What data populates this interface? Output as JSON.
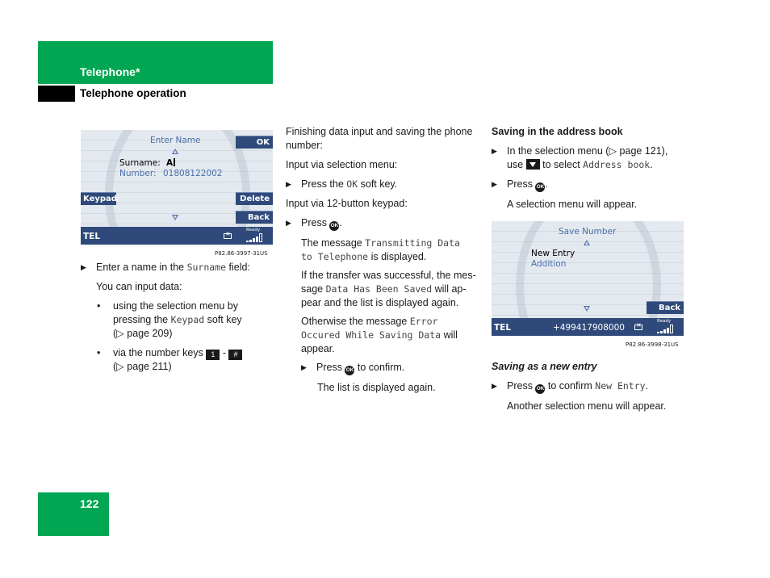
{
  "header": {
    "chapter": "Telephone*",
    "section": "Telephone operation"
  },
  "page_number": "122",
  "screen1": {
    "title": "Enter Name",
    "surname_label": "Surname:",
    "surname_value": "A",
    "number_label": "Number:",
    "number_value": "01808122002",
    "softkeys": {
      "ok": "OK",
      "keypad": "Keypad",
      "delete": "Delete",
      "back": "Back"
    },
    "status": {
      "tel": "TEL",
      "ready": "Ready"
    },
    "caption": "P82.86-3997-31US"
  },
  "col1": {
    "step1_pre": "Enter a name in the ",
    "step1_mono": "Surname",
    "step1_post": " field:",
    "para1": "You can input data:",
    "bullet1_line1": "using the selection menu by",
    "bullet1_line2_pre": "pressing the ",
    "bullet1_line2_mono": "Keypad",
    "bullet1_line2_post": " soft key",
    "bullet1_line3": "(▷ page 209)",
    "bullet2_pre": "via the number keys ",
    "bullet2_key1": "1",
    "bullet2_sep": " - ",
    "bullet2_key2": "#",
    "bullet2_line2": "(▷ page 211)"
  },
  "col2": {
    "para1_line1": "Finishing data input and saving the phone",
    "para1_line2": "number:",
    "para2": "Input via selection menu:",
    "step1_pre": "Press the ",
    "step1_mono": "OK",
    "step1_post": " soft key.",
    "para3": "Input via 12-button keypad:",
    "step2": "Press",
    "ok_icon": "OK",
    "msg1_pre": "The message ",
    "msg1_mono1": "Transmitting Data",
    "msg1_mono2": "to Telephone",
    "msg1_post": " is displayed.",
    "msg2_line1": "If the transfer was successful, the mes-",
    "msg2_line2_pre": "sage ",
    "msg2_line2_mono": "Data Has Been Saved",
    "msg2_line2_post": " will ap-",
    "msg2_line3": "pear and the list is displayed again.",
    "msg3_line1_pre": "Otherwise the message ",
    "msg3_line1_mono": "Error",
    "msg3_line2_mono": "Occured While Saving Data",
    "msg3_line2_post": " will",
    "msg3_line3": "appear.",
    "step3_pre": "Press ",
    "step3_post": " to confirm.",
    "result": "The list is displayed again."
  },
  "col3": {
    "heading": "Saving in the address book",
    "step1_line1": "In the selection menu (▷ page 121),",
    "step1_line2_pre": "use ",
    "step1_line2_mid": " to select ",
    "step1_line2_mono": "Address book",
    "step1_line2_post": ".",
    "step2_pre": "Press ",
    "step2_post": ".",
    "result1": "A selection menu will appear.",
    "subheading": "Saving as a new entry",
    "step3_pre": "Press ",
    "step3_mid": " to confirm ",
    "step3_mono": "New Entry",
    "step3_post": ".",
    "result2": "Another selection menu will appear."
  },
  "screen2": {
    "title": "Save Number",
    "option1": "New Entry",
    "option2": "Addition",
    "softkeys": {
      "back": "Back"
    },
    "status": {
      "tel": "TEL",
      "number": "+499417908000",
      "ready": "Ready"
    },
    "caption": "P82.86-3998-31US"
  },
  "colors": {
    "brand_green": "#00a651",
    "screen_blue": "#2f4a7a",
    "screen_text_blue": "#4a6fa8"
  }
}
